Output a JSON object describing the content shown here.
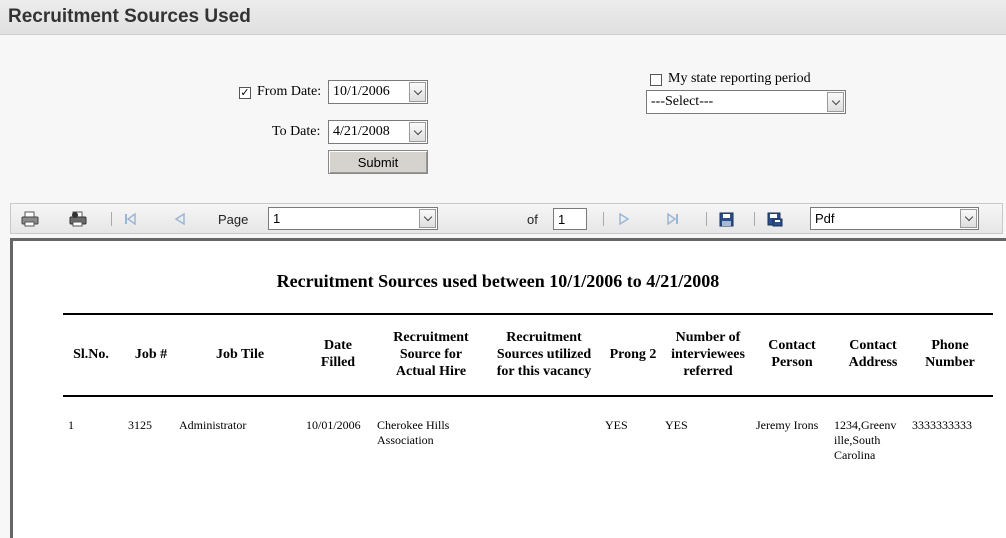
{
  "page": {
    "title": "Recruitment Sources Used"
  },
  "filters": {
    "from_date_label": "From Date:",
    "from_date_value": "10/1/2006",
    "from_date_checked": "✓",
    "to_date_label": "To Date:",
    "to_date_value": "4/21/2008",
    "submit_label": "Submit",
    "state_period_label": "My state reporting period",
    "state_period_select": "---Select---"
  },
  "toolbar": {
    "page_label": "Page",
    "page_value": "1",
    "of_label": "of",
    "total_pages": "1",
    "export_format": "Pdf"
  },
  "report": {
    "title": "Recruitment Sources used between 10/1/2006 to 4/21/2008",
    "columns": [
      "Sl.No.",
      "Job #",
      "Job Tile",
      "Date\nFilled",
      "Recruitment\nSource for\nActual Hire",
      "Recruitment\nSources utilized\nfor this vacancy",
      "Prong 2",
      "Number of\ninterviewees\nreferred",
      "Contact\nPerson",
      "Contact\nAddress",
      "Phone\nNumber"
    ],
    "rows": [
      {
        "sl_no": "1",
        "job_no": "3125",
        "job_title": "Administrator",
        "date_filled": "10/01/2006",
        "source_actual_hire": "Cherokee Hills\nAssociation",
        "sources_utilized": "",
        "prong2": "YES",
        "interviewees": "YES",
        "contact_person": "Jeremy Irons",
        "contact_address": "1234,Greenv\nille,South\nCarolina",
        "phone": "3333333333"
      }
    ]
  }
}
